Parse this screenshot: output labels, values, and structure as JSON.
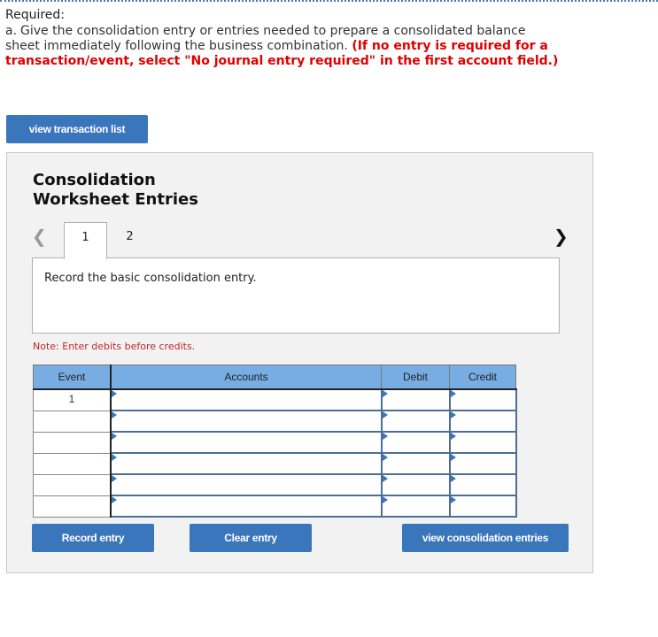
{
  "header": {
    "required_label": "Required:",
    "question_letter": "a.",
    "question_text": "Give the consolidation entry or entries needed to prepare a consolidated balance sheet immediately following the business combination.",
    "question_instruction": "(If no entry is required for a transaction/event, select \"No journal entry required\" in the first account field.)"
  },
  "buttons": {
    "view_transaction_list": "view transaction list",
    "record_entry": "Record entry",
    "clear_entry": "Clear entry",
    "view_consolidation_entries": "view consolidation entries"
  },
  "panel": {
    "title_line1": "Consolidation",
    "title_line2": "Worksheet Entries",
    "prev_icon": "chevron-left-icon",
    "next_icon": "chevron-right-icon",
    "tabs": [
      {
        "label": "1",
        "active": true
      },
      {
        "label": "2",
        "active": false
      }
    ],
    "description": "Record the basic consolidation entry.",
    "note": "Note: Enter debits before credits."
  },
  "table": {
    "columns": [
      "Event",
      "Accounts",
      "Debit",
      "Credit"
    ],
    "rows": [
      {
        "event": "1",
        "account": "",
        "debit": "",
        "credit": ""
      },
      {
        "event": "",
        "account": "",
        "debit": "",
        "credit": ""
      },
      {
        "event": "",
        "account": "",
        "debit": "",
        "credit": ""
      },
      {
        "event": "",
        "account": "",
        "debit": "",
        "credit": ""
      },
      {
        "event": "",
        "account": "",
        "debit": "",
        "credit": ""
      },
      {
        "event": "",
        "account": "",
        "debit": "",
        "credit": ""
      }
    ]
  },
  "colors": {
    "button_blue": "#3a76bb",
    "header_blue": "#78ade3",
    "instruction_red": "#e00000",
    "note_red": "#c0262d"
  }
}
